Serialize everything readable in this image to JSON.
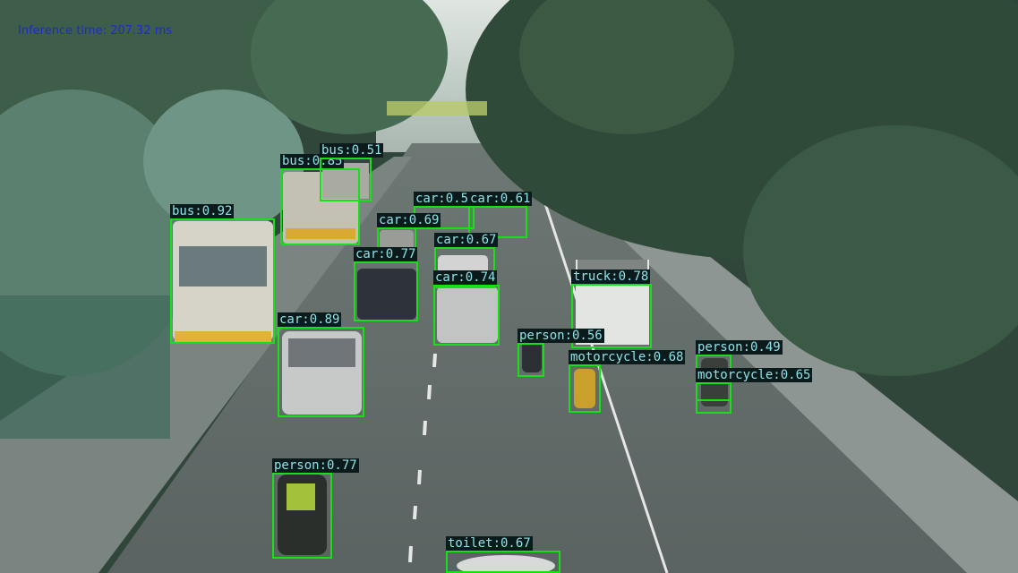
{
  "overlay": {
    "inference_text": "Inference time: 207.32 ms"
  },
  "detections": [
    {
      "label": "bus:0.92"
    },
    {
      "label": "bus:0.85"
    },
    {
      "label": "bus:0.51"
    },
    {
      "label": "car:0.56"
    },
    {
      "label": "car:0.61"
    },
    {
      "label": "car:0.69"
    },
    {
      "label": "car:0.67"
    },
    {
      "label": "car:0.77"
    },
    {
      "label": "car:0.74"
    },
    {
      "label": "truck:0.78"
    },
    {
      "label": "car:0.89"
    },
    {
      "label": "person:0.56"
    },
    {
      "label": "motorcycle:0.68"
    },
    {
      "label": "person:0.49"
    },
    {
      "label": "motorcycle:0.65"
    },
    {
      "label": "person:0.77"
    },
    {
      "label": "toilet:0.67"
    }
  ]
}
